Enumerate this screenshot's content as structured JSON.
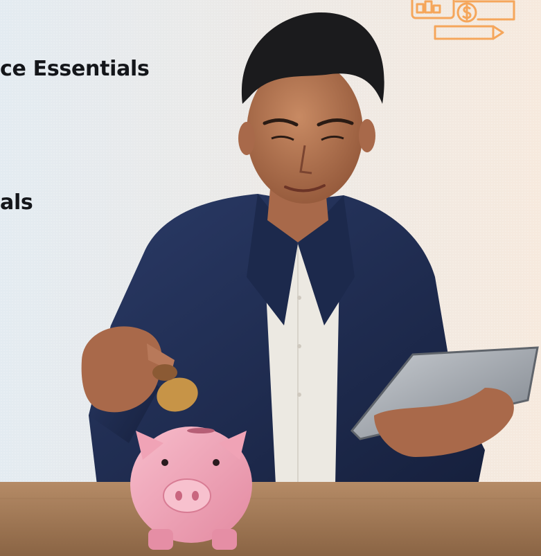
{
  "content": {
    "heading_primary": "ce Essentials",
    "heading_secondary": "als"
  },
  "decoration": {
    "icon": "finance-calculator-coin-pencil-icon",
    "icon_color": "#f5a65b"
  },
  "photo": {
    "subject": "person-saving-coin-piggy-bank",
    "colors": {
      "jacket": "#1f2d54",
      "shirt": "#ece9e2",
      "piggy_bank": "#f0a3b6",
      "desk": "#a07a58",
      "tablet": "#9ea3aa"
    }
  }
}
